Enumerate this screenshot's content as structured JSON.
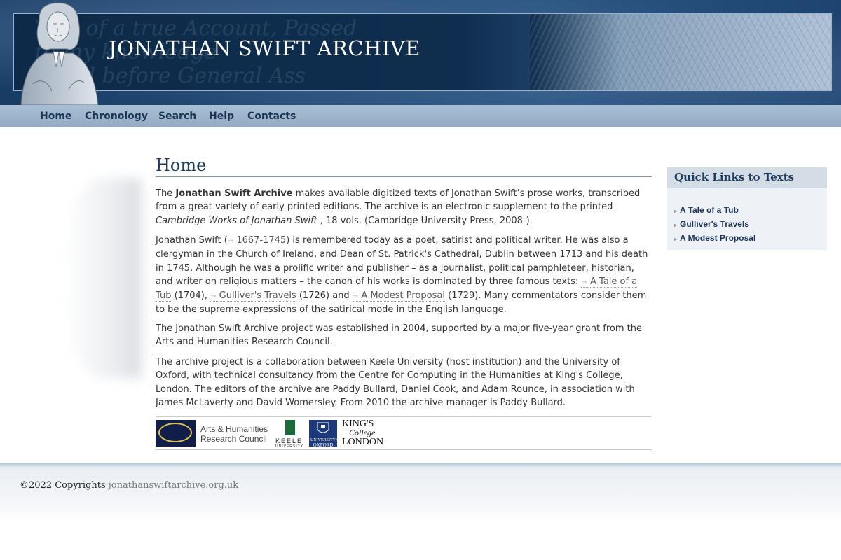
{
  "header": {
    "title": "JONATHAN SWIFT ARCHIVE",
    "portrait_icon": "portrait-engraving-icon",
    "background_script": [
      "Tale of a true Account, Passed",
      "to my knowledge",
      "erved before General Ass"
    ]
  },
  "nav": {
    "items": [
      "Home",
      "Chronology",
      "Search",
      "Help",
      "Contacts"
    ]
  },
  "main": {
    "title": "Home",
    "p1": {
      "pre": "The ",
      "bold": "Jonathan Swift Archive",
      "mid": " makes available digitized texts of Jonathan Swift’s prose works, transcribed from a great variety of early printed editions. The archive is an electronic supplement to the printed ",
      "italic": "Cambridge Works of Jonathan Swift",
      "post": " , 18 vols. (Cambridge University Press, 2008-)."
    },
    "p2": {
      "a": "Jonathan Swift (",
      "link_dates": "1667-1745",
      "b": ") is remembered today as a poet, satirist and political writer. He was also a clergyman in the Church of Ireland, and Dean of St. Patrick's Cathedral, Dublin between 1713 and his death in 1745. Although he was a prolific writer and publisher – as a journalist, political pamphleteer, historian, and writer on religious matters – the canon of his works is dominated by three famous texts: ",
      "link_tub": "A Tale of a Tub",
      "c": " (1704), ",
      "link_gulliver": "Gulliver's Travels",
      "d": " (1726) and ",
      "link_modest": "A Modest Proposal",
      "e": " (1729). Many commentators consider them to be the supreme expressions of the satirical mode in the English language."
    },
    "p3": "The Jonathan Swift Archive project was established in 2004, supported by a major five-year grant from the Arts and Humanities Research Council.",
    "p4": "The archive project is a collaboration between Keele University (host institution) and the University of Oxford, with technical consultancy from the Centre for Computing in the Humanities at King's College, London. The editors of the archive are Paddy Bullard, Daniel Cook, and Adam Rounce, in association with James McLaverty and David Womersley. From 2010 the archive manager is Paddy Bullard.",
    "link_arrow": "⇾",
    "logos": {
      "ahrc_line1": "Arts & Humanities",
      "ahrc_line2": "Research Council",
      "keele": "KEELE",
      "keele_sub": "UNIVERSITY",
      "oxford_line1": "UNIVERSITY OF",
      "oxford_line2": "OXFORD",
      "kings_line1": "KING'S",
      "kings_line2": "College",
      "kings_line3": "LONDON"
    }
  },
  "sidebar": {
    "title": "Quick Links to Texts",
    "links": [
      "A Tale of a Tub",
      "Gulliver's Travels",
      "A Modest Proposal"
    ],
    "arrow": "▸"
  },
  "footer": {
    "copyright": "©2022 Copyrights",
    "site": "jonathanswiftarchive.org.uk"
  }
}
